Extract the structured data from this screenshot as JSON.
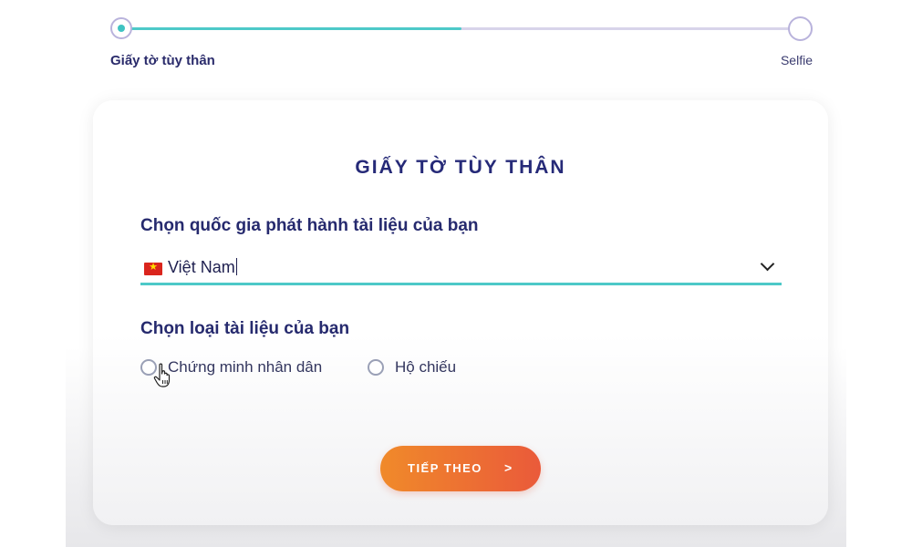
{
  "stepper": {
    "progress": 0.5,
    "steps": [
      {
        "label": "Giấy tờ tùy thân",
        "state": "active"
      },
      {
        "label": "Selfie",
        "state": "pending"
      }
    ]
  },
  "card": {
    "title": "GIẤY TỜ TÙY THÂN",
    "country_question": "Chọn quốc gia phát hành tài liệu của bạn",
    "country_value": "Việt Nam",
    "country_flag_icon": "vietnam-flag-icon",
    "doc_type_question": "Chọn loại tài liệu của bạn",
    "doc_options": [
      {
        "label": "Chứng minh nhân dân",
        "selected": false
      },
      {
        "label": "Hộ chiếu",
        "selected": false
      }
    ],
    "next_button": {
      "label": "TIẾP THEO",
      "arrow": ">"
    }
  },
  "colors": {
    "accent_teal": "#4dc9c8",
    "title_navy": "#262a78",
    "button_start": "#f08a2a",
    "button_end": "#ea5a3a"
  }
}
